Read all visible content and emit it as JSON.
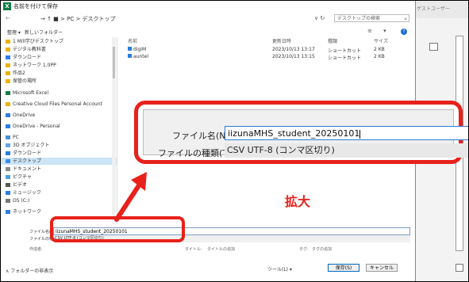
{
  "dialog": {
    "title": "名前を付けて保存",
    "breadcrumb": "→  ↑  ■ > PC > デスクトップ",
    "search_placeholder": "デスクトップの検索",
    "organize": "整理 ▾",
    "new_folder": "新しいフォルダー"
  },
  "sidebar": {
    "items": [
      {
        "label": "1 Mill学びデスクトップ"
      },
      {
        "label": "デジタル教科書"
      },
      {
        "label": "ダウンロード"
      },
      {
        "label": "ネットワーク 1.0PP"
      },
      {
        "label": "作品2"
      },
      {
        "label": "保管の場所"
      },
      {
        "label": "Microsoft Excel"
      },
      {
        "label": "Creative Cloud Files Personal Account"
      },
      {
        "label": "OneDrive"
      },
      {
        "label": "OneDrive - Personal"
      },
      {
        "label": "PC"
      },
      {
        "label": "3D オブジェクト"
      },
      {
        "label": "ダウンロード"
      },
      {
        "label": "デスクトップ"
      },
      {
        "label": "ドキュメント"
      },
      {
        "label": "ピクチャ"
      },
      {
        "label": "ビデオ"
      },
      {
        "label": "ミュージック"
      },
      {
        "label": "OS (C:)"
      },
      {
        "label": "ネットワーク"
      }
    ]
  },
  "filelist": {
    "headers": [
      "名前",
      "更新日時",
      "種類",
      "サイズ"
    ],
    "rows": [
      {
        "name": "digiM",
        "date": "2023/10/13 13:17",
        "type": "ショートカット",
        "size": "2 KB"
      },
      {
        "name": "auntel",
        "date": "2023/10/13 13:15",
        "type": "ショートカット",
        "size": "2 KB"
      }
    ]
  },
  "form": {
    "filename_label": "ファイル名(N):",
    "filename_value": "iizunaMHS_student_20250101",
    "filetype_label": "ファイルの種類(T):",
    "filetype_value": "CSV UTF-8 (コンマ区切り)",
    "authors_label": "作成者:",
    "title_label": "タイトル:",
    "title_value": "タイトルの追加",
    "tags_label": "タグ:",
    "tags_value": "タグの追加"
  },
  "bottom": {
    "hide_folders": "∧ フォルダーの非表示",
    "tools": "ツール(L) ▾",
    "save": "保存(S)",
    "cancel": "キャンセル"
  },
  "callout": {
    "zoom_label": "拡大"
  },
  "background_window": {
    "account": "ゲストユーザー"
  },
  "colors": {
    "callout": "#e8211b",
    "excel": "#107c41",
    "selection": "#cce4f7"
  }
}
